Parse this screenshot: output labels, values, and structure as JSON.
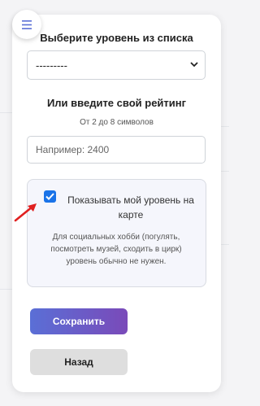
{
  "header": {
    "menu_icon": "hamburger-icon"
  },
  "level_section": {
    "title": "Выберите уровень из списка",
    "select_value": "---------"
  },
  "rating_section": {
    "title": "Или введите свой рейтинг",
    "hint": "От 2 до 8 символов",
    "input_value": "",
    "input_placeholder": "Например: 2400"
  },
  "map_option": {
    "checked": true,
    "label": "Показывать мой уровень на карте",
    "description": "Для социальных хобби (погулять, посмотреть музей, сходить в цирк) уровень обычно не нужен."
  },
  "buttons": {
    "save_label": "Сохранить",
    "back_label": "Назад"
  },
  "colors": {
    "accent": "#1a73e8",
    "save_gradient_start": "#5a6fd6",
    "save_gradient_end": "#7a4ab9",
    "annotation_arrow": "#e02020"
  }
}
